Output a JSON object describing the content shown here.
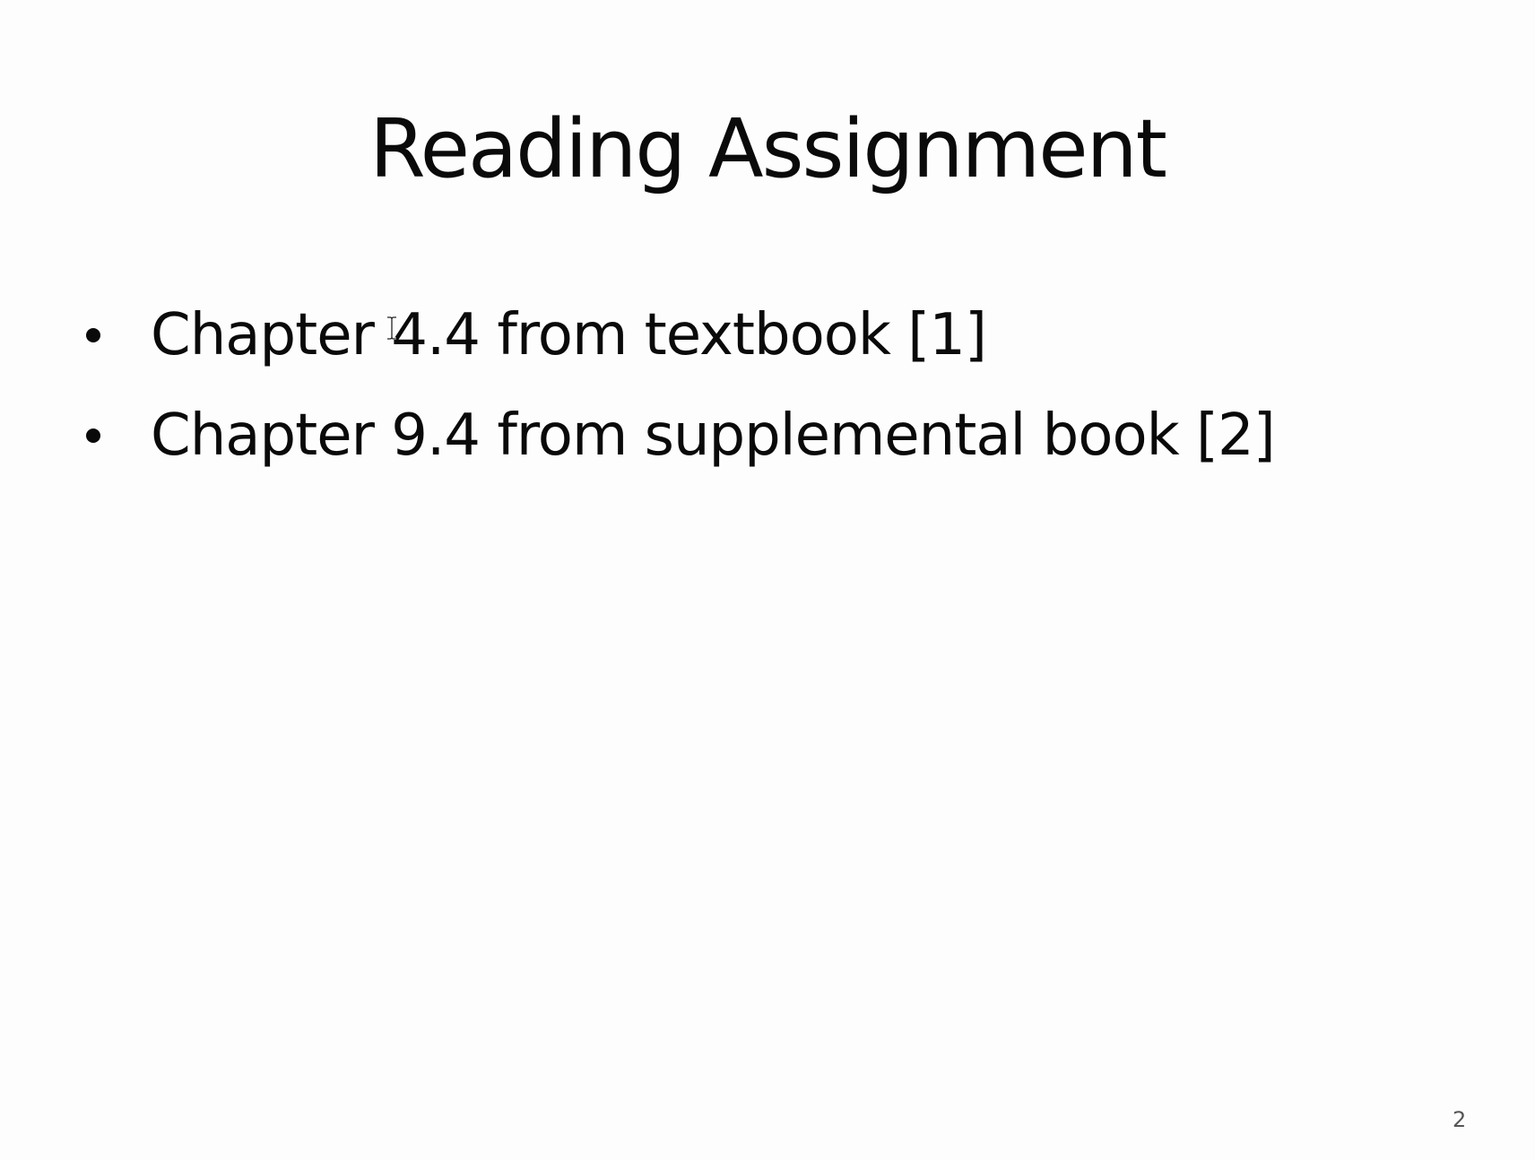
{
  "slide": {
    "title": "Reading Assignment",
    "bullets": [
      {
        "text": "Chapter 4.4 from textbook [1]"
      },
      {
        "text": "Chapter 9.4 from supplemental book [2]"
      }
    ],
    "page_number": "2"
  },
  "cursor": {
    "icon": "text-cursor-icon"
  },
  "colors": {
    "background": "#fdfdfd",
    "text": "#0a0a0a",
    "page_number": "#555555"
  }
}
